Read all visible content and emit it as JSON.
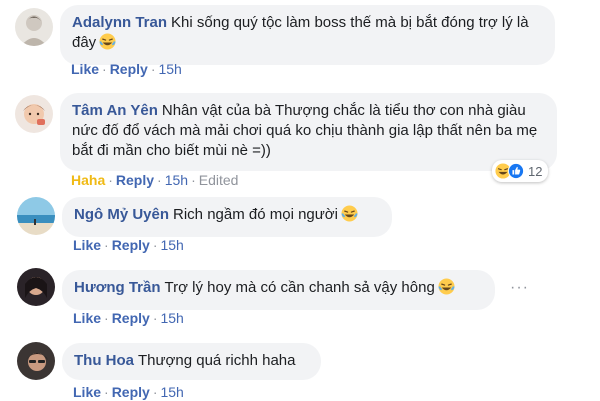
{
  "comments": [
    {
      "author": "Adalynn Tran",
      "text": "Khi sống quý tộc làm boss thế mà bị bắt đóng trợ lý là đây",
      "like": "Like",
      "reply": "Reply",
      "time": "15h",
      "sep": "·"
    },
    {
      "author": "Tâm An Yên",
      "text": "Nhân vật của bà Thượng chắc là tiểu thơ con nhà giàu nức đố đổ vách mà mải chơi quá ko chịu thành gia lập thất nên ba mẹ bắt đi mần cho biết mùi nè =))",
      "reaction": "Haha",
      "reply": "Reply",
      "time": "15h",
      "edited": "Edited",
      "reaction_count": "12",
      "sep": "·"
    },
    {
      "author": "Ngô Mỷ Uyên",
      "text": "Rich ngầm đó mọi người",
      "like": "Like",
      "reply": "Reply",
      "time": "15h",
      "sep": "·"
    },
    {
      "author": "Hương Trần",
      "text": "Trợ lý hoy mà có cần chanh sả vậy hông",
      "like": "Like",
      "reply": "Reply",
      "time": "15h",
      "more": "···",
      "sep": "·"
    },
    {
      "author": "Thu Hoa",
      "text": "Thượng quá richh haha",
      "like": "Like",
      "reply": "Reply",
      "time": "15h",
      "sep": "·"
    }
  ],
  "colors": {
    "author": "#385898",
    "link": "#4267b2",
    "haha": "#f0ba15",
    "bubble": "#f2f3f5",
    "muted": "#90949c"
  },
  "icons": [
    "laughing-emoji-icon",
    "like-reaction-icon",
    "more-options-icon"
  ]
}
